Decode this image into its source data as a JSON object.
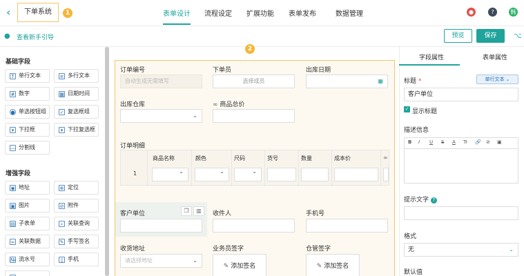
{
  "header": {
    "back_icon": "chevron-left-icon",
    "app_name": "下单系统",
    "badge1": "1",
    "nav": [
      "表单设计",
      "流程设定",
      "扩展功能",
      "表单发布",
      "数据管理"
    ],
    "avatar_text": "韩",
    "accent": "#1fa39b"
  },
  "subbar": {
    "guide": "查看新手引导",
    "preview": "预览",
    "save": "保存"
  },
  "palette": {
    "basic_title": "基础字段",
    "basic": [
      "单行文本",
      "多行文本",
      "数字",
      "日期时间",
      "单选按钮组",
      "复选框组",
      "下拉框",
      "下拉复选框",
      "分割线"
    ],
    "enhanced_title": "增强字段",
    "enhanced": [
      "地址",
      "定位",
      "图片",
      "附件",
      "子表单",
      "关联查询",
      "关联数据",
      "手写签名",
      "流水号",
      "手机"
    ]
  },
  "canvas": {
    "badge2": "2",
    "order_no": "订单编号",
    "order_no_placeholder": "自动生成无需填写",
    "orderer": "下单员",
    "orderer_placeholder": "选择成员",
    "out_date": "出库日期",
    "warehouse": "出库仓库",
    "total_price": "商品总价",
    "order_detail": "订单明细",
    "table_headers": [
      "商品名称",
      "颜色",
      "尺码",
      "货号",
      "数量",
      "成本价"
    ],
    "row_no": "1",
    "customer": "客户单位",
    "receiver": "收件人",
    "phone": "手机号",
    "address": "收货地址",
    "address_placeholder": "请选择地址",
    "salesman_sign": "业务员签字",
    "keeper_sign": "仓管签字",
    "add_sign": "添加签名"
  },
  "right": {
    "tab_field": "字段属性",
    "tab_form": "表单属性",
    "title_label": "标题",
    "required_mark": "*",
    "type_chip": "单行文本",
    "title_value": "客户单位",
    "show_title": "显示标题",
    "desc_label": "描述信息",
    "rte_buttons": [
      "B",
      "I",
      "U",
      "S",
      "A",
      "Tr",
      "🔗",
      "⊘",
      "▣"
    ],
    "hint_label": "提示文字",
    "format_label": "格式",
    "format_value": "无",
    "default_label": "默认值"
  }
}
